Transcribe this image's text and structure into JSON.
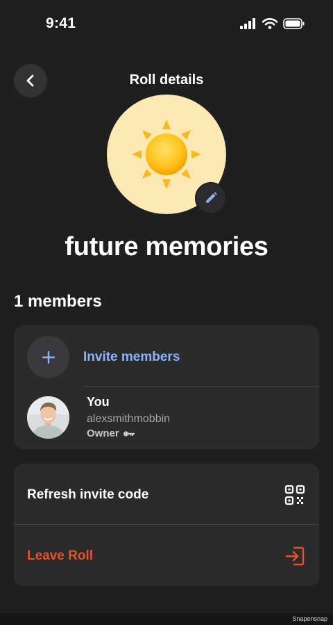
{
  "status_bar": {
    "time": "9:41",
    "icons": [
      "signal-icon",
      "wifi-icon",
      "battery-icon"
    ]
  },
  "header": {
    "title": "Roll details",
    "back_icon": "chevron-left-icon"
  },
  "roll": {
    "name": "future memories",
    "cover_icon": "sun-emoji",
    "cover_bg": "#fbe8b3",
    "edit_icon": "pencil-icon"
  },
  "members": {
    "heading": "1 members",
    "invite_label": "Invite members",
    "list": [
      {
        "name": "You",
        "username": "alexsmithmobbin",
        "role": "Owner",
        "role_icon": "key-icon"
      }
    ]
  },
  "actions": {
    "refresh_label": "Refresh invite code",
    "refresh_icon": "qr-code-icon",
    "leave_label": "Leave Roll",
    "leave_icon": "exit-icon"
  },
  "colors": {
    "background": "#1f1f1f",
    "card": "#2b2b2b",
    "accent_blue": "#8ab4f8",
    "destructive": "#e8502c"
  },
  "footer": {
    "watermark": "Snapensnap"
  }
}
